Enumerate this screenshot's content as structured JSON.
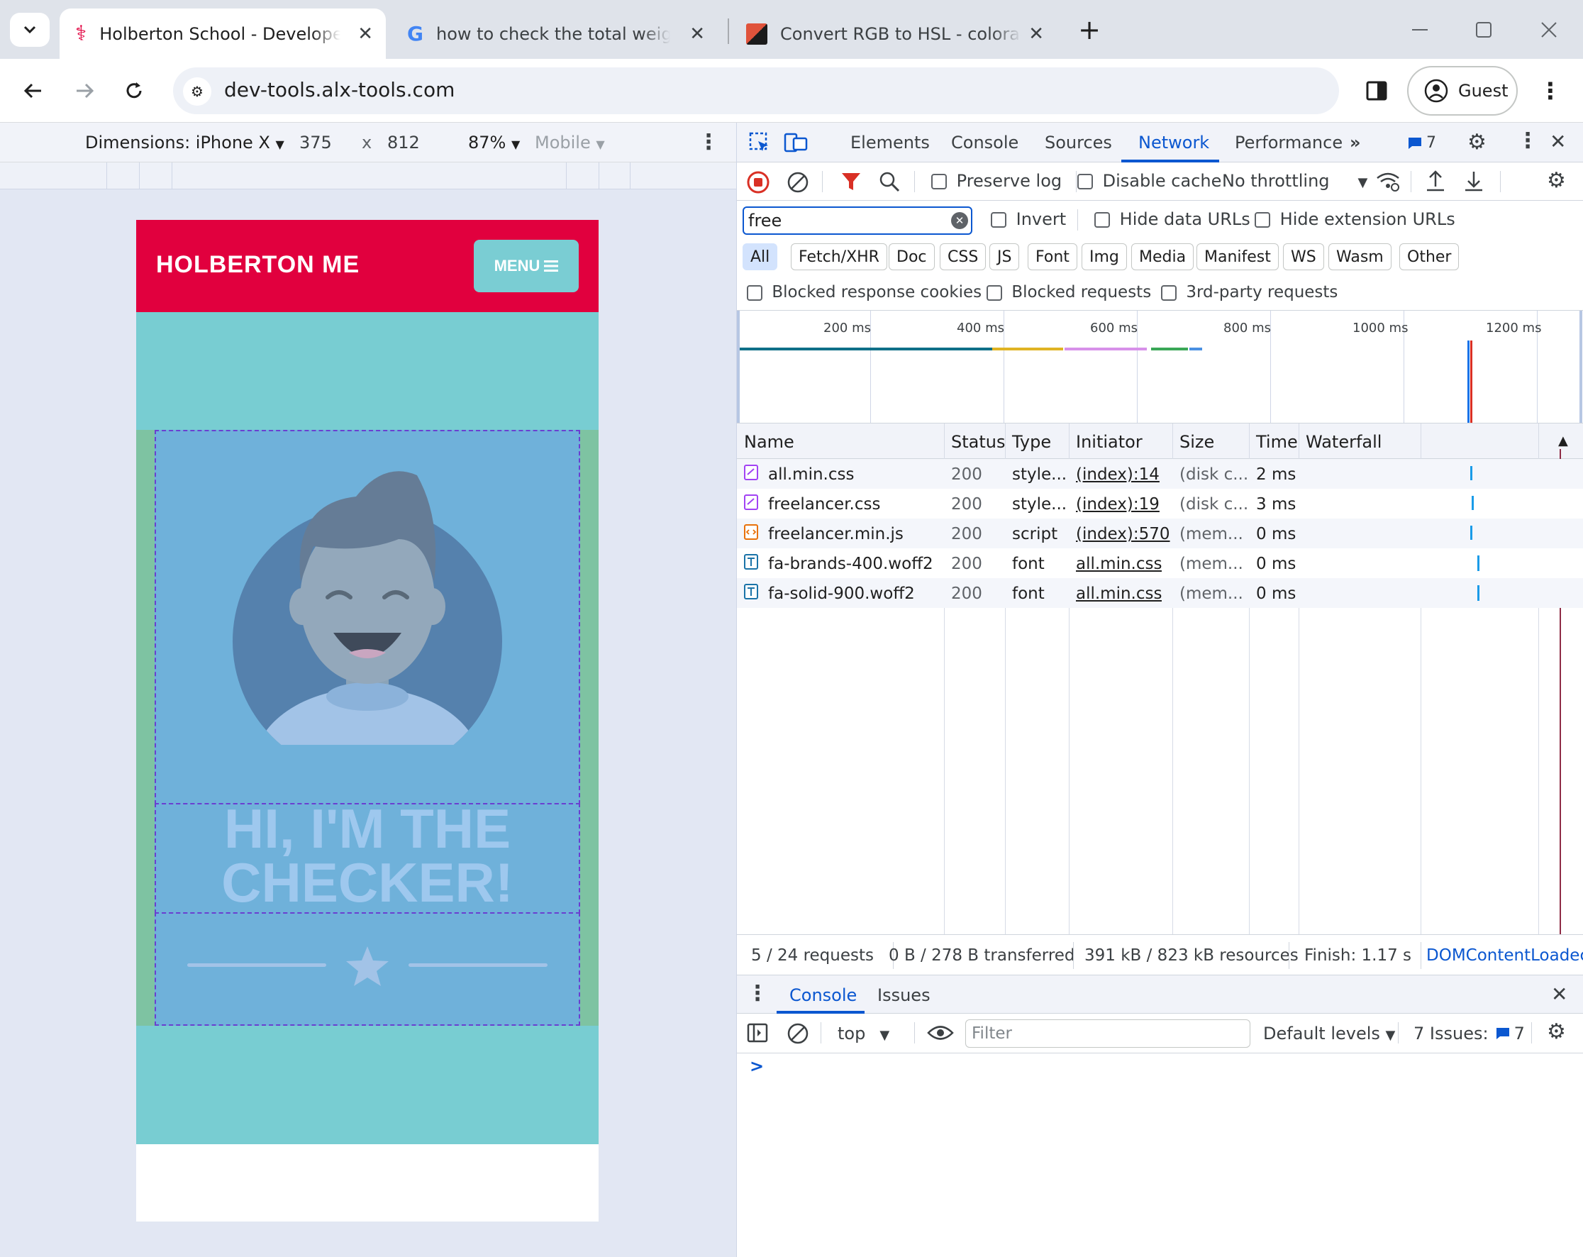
{
  "browser": {
    "tabs": [
      {
        "title": "Holberton School - Developer t",
        "active": true
      },
      {
        "title": "how to check the total weight o",
        "active": false
      },
      {
        "title": "Convert RGB to HSL - coloradesi",
        "active": false
      }
    ],
    "url": "dev-tools.alx-tools.com",
    "profile_label": "Guest"
  },
  "device_toolbar": {
    "dimensions_label": "Dimensions: iPhone X",
    "width": "375",
    "times": "x",
    "height": "812",
    "zoom": "87%",
    "mode": "Mobile"
  },
  "page": {
    "brand": "HOLBERTON ME",
    "menu_label": "MENU",
    "heading_line1": "HI, I'M THE",
    "heading_line2": "CHECKER!",
    "colors": {
      "nav": "#e1003e",
      "masthead": "#78cdd2",
      "highlight": "#6fb1da"
    }
  },
  "devtools": {
    "panels": [
      "Elements",
      "Console",
      "Sources",
      "Network",
      "Performance"
    ],
    "active_panel": "Network",
    "issues_count": "7",
    "network_toolbar": {
      "preserve_log": "Preserve log",
      "disable_cache": "Disable cache",
      "throttling": "No throttling"
    },
    "filter": {
      "value": "free",
      "invert": "Invert",
      "hide_data_urls": "Hide data URLs",
      "hide_extension_urls": "Hide extension URLs"
    },
    "type_filters": [
      "All",
      "Fetch/XHR",
      "Doc",
      "CSS",
      "JS",
      "Font",
      "Img",
      "Media",
      "Manifest",
      "WS",
      "Wasm",
      "Other"
    ],
    "active_type_filter": "All",
    "block_filters": [
      "Blocked response cookies",
      "Blocked requests",
      "3rd-party requests"
    ],
    "timeline_ticks": [
      "200 ms",
      "400 ms",
      "600 ms",
      "800 ms",
      "1000 ms",
      "1200 ms"
    ],
    "columns": [
      "Name",
      "Status",
      "Type",
      "Initiator",
      "Size",
      "Time",
      "Waterfall"
    ],
    "rows": [
      {
        "name": "all.min.css",
        "status": "200",
        "type": "style...",
        "initiator": "(index):14",
        "size": "(disk c...",
        "time": "2 ms",
        "icon": "css-file-icon"
      },
      {
        "name": "freelancer.css",
        "status": "200",
        "type": "style...",
        "initiator": "(index):19",
        "size": "(disk c...",
        "time": "3 ms",
        "icon": "css-file-icon"
      },
      {
        "name": "freelancer.min.js",
        "status": "200",
        "type": "script",
        "initiator": "(index):570",
        "size": "(mem...",
        "time": "0 ms",
        "icon": "script-file-icon"
      },
      {
        "name": "fa-brands-400.woff2",
        "status": "200",
        "type": "font",
        "initiator": "all.min.css",
        "size": "(mem...",
        "time": "0 ms",
        "icon": "font-file-icon"
      },
      {
        "name": "fa-solid-900.woff2",
        "status": "200",
        "type": "font",
        "initiator": "all.min.css",
        "size": "(mem...",
        "time": "0 ms",
        "icon": "font-file-icon"
      }
    ],
    "summary": {
      "requests": "5 / 24 requests",
      "transferred": "0 B / 278 B transferred",
      "resources": "391 kB / 823 kB resources",
      "finish": "Finish: 1.17 s",
      "dom": "DOMContentLoadec"
    },
    "drawer": {
      "tabs": [
        "Console",
        "Issues"
      ],
      "active_tab": "Console",
      "context": "top",
      "filter_placeholder": "Filter",
      "levels": "Default levels",
      "issues_label": "7 Issues:",
      "issues_count": "7",
      "prompt": ">"
    }
  }
}
